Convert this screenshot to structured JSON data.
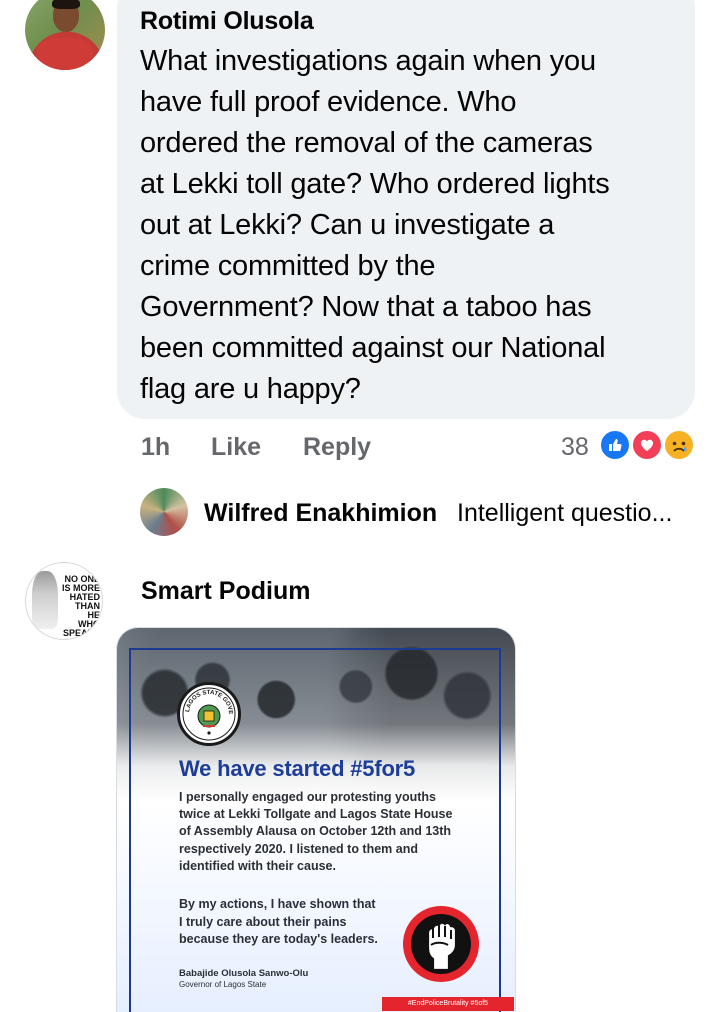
{
  "comments": [
    {
      "author": "Rotimi Olusola",
      "text": "What investigations again when you\nhave full proof evidence. Who\nordered the removal of the cameras\nat Lekki toll gate? Who ordered lights\nout at Lekki? Can u investigate a\ncrime committed by the\nGovernment? Now that a taboo has\nbeen committed against our National\nflag are u happy?",
      "time": "1h",
      "like_label": "Like",
      "reply_label": "Reply",
      "reaction_count": "38",
      "reactions": [
        "like-icon",
        "love-icon",
        "sad-icon"
      ],
      "reply_preview": {
        "author": "Wilfred Enakhimion",
        "text": "Intelligent questio..."
      }
    },
    {
      "author": "Smart Podium",
      "avatar_text": "NO ONE\nIS MORE\nHATED\nTHAN HE\nWHO SPEAKS\nTHE TRUTH"
    }
  ],
  "poster": {
    "seal_text": "LAGOS STATE GOVERNMENT",
    "headline": "We have started #5for5",
    "paragraph_1": "I personally engaged our protesting youths\ntwice at Lekki Tollgate and Lagos State House\nof Assembly Alausa on October 12th and 13th\nrespectively 2020.  I listened to them and\nidentified with their cause.",
    "paragraph_2": "By my actions, I have shown that\nI truly care about their pains\nbecause they are today's leaders.",
    "signature": "Babajide Olusola Sanwo-Olu",
    "role": "Governor of Lagos State",
    "hashtag": "#EndPoliceBrutality #5of5"
  },
  "colors": {
    "bubble": "#eff2f5",
    "meta_text": "#65676b",
    "like_blue": "#1877f2",
    "love_red": "#f33e58",
    "sad_yellow": "#f7b125",
    "poster_blue": "#1e3d96",
    "poster_red": "#e5252d"
  }
}
